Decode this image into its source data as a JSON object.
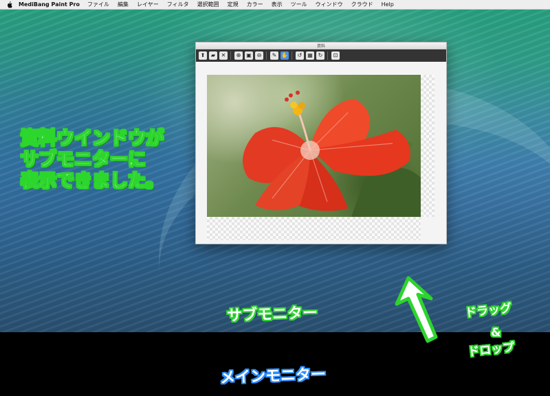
{
  "menubar": {
    "app_name": "MediBang Paint Pro",
    "items": [
      "ファイル",
      "編集",
      "レイヤー",
      "フィルタ",
      "選択範囲",
      "定規",
      "カラー",
      "表示",
      "ツール",
      "ウィンドウ",
      "クラウド",
      "Help"
    ]
  },
  "ref_window": {
    "title": "資料",
    "toolbar": [
      {
        "name": "open-cloud-icon",
        "glyph": "⬆"
      },
      {
        "name": "folder-icon",
        "glyph": "▰"
      },
      {
        "name": "close-icon",
        "glyph": "✕"
      },
      {
        "name": "zoom-in-icon",
        "glyph": "⊕"
      },
      {
        "name": "fit-icon",
        "glyph": "▣"
      },
      {
        "name": "zoom-out-icon",
        "glyph": "⊖"
      },
      {
        "name": "eyedropper-icon",
        "glyph": "✎"
      },
      {
        "name": "hand-icon",
        "glyph": "✋",
        "active": true
      },
      {
        "name": "rotate-left-icon",
        "glyph": "↺"
      },
      {
        "name": "rotate-reset-icon",
        "glyph": "▦"
      },
      {
        "name": "rotate-right-icon",
        "glyph": "↻"
      },
      {
        "name": "pin-icon",
        "glyph": "⊡"
      }
    ]
  },
  "annotations": {
    "caption_lines": [
      "資料ウインドウが",
      "サブモニターに",
      "表示できました。"
    ],
    "sub_monitor_label": "サブモニター",
    "main_monitor_label": "メインモニター",
    "drag_drop_lines": [
      "ドラッグ",
      "&",
      "ドロップ"
    ]
  },
  "colors": {
    "annotation_green": "#2ed42e",
    "annotation_blue": "#2f8fff",
    "toolbar_active": "#4b8fe6"
  }
}
